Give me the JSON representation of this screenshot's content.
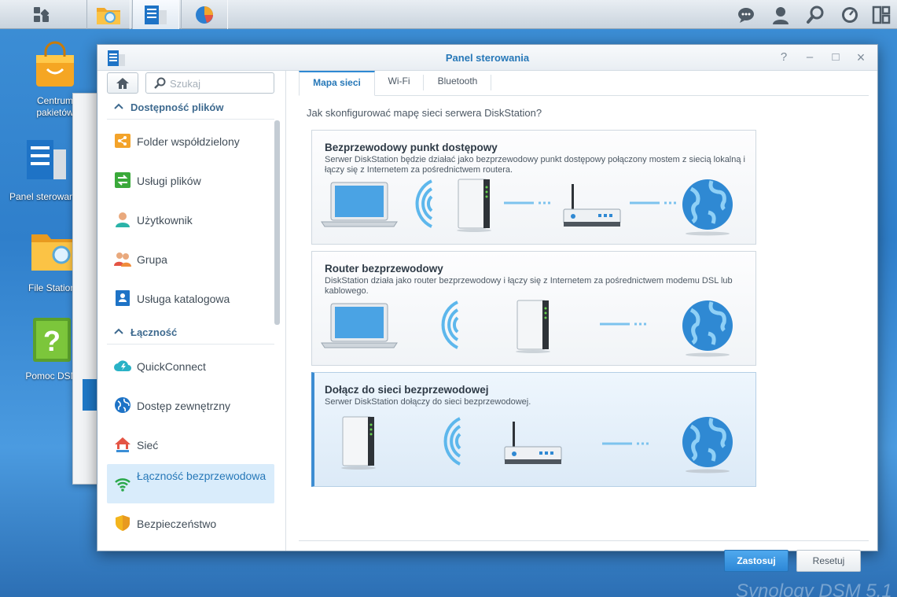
{
  "desktop": {
    "icons": [
      {
        "label": "Centrum pakietów"
      },
      {
        "label": "Panel sterowania"
      },
      {
        "label": "File Station"
      },
      {
        "label": "Pomoc DSM"
      }
    ],
    "watermark": "Synology DSM 5.1"
  },
  "window": {
    "title": "Panel sterowania",
    "controls": {
      "help": "?",
      "minimize": "–",
      "maximize": "□",
      "close": "×"
    }
  },
  "sidebar": {
    "search_placeholder": "Szukaj",
    "sections": [
      {
        "label": "Dostępność plików"
      },
      {
        "label": "Łączność"
      }
    ],
    "items": [
      {
        "label": "Folder współdzielony",
        "icon": "shared-folder-icon"
      },
      {
        "label": "Usługi plików",
        "icon": "file-services-icon"
      },
      {
        "label": "Użytkownik",
        "icon": "user-icon"
      },
      {
        "label": "Grupa",
        "icon": "group-icon"
      },
      {
        "label": "Usługa katalogowa",
        "icon": "directory-service-icon"
      },
      {
        "label": "QuickConnect",
        "icon": "quickconnect-icon"
      },
      {
        "label": "Dostęp zewnętrzny",
        "icon": "external-access-icon"
      },
      {
        "label": "Sieć",
        "icon": "network-icon"
      },
      {
        "label": "Łączność bezprzewodowa",
        "icon": "wireless-icon"
      },
      {
        "label": "Bezpieczeństwo",
        "icon": "security-icon"
      }
    ]
  },
  "tabs": [
    {
      "label": "Mapa sieci"
    },
    {
      "label": "Wi-Fi"
    },
    {
      "label": "Bluetooth"
    }
  ],
  "content": {
    "question": "Jak skonfigurować mapę sieci serwera DiskStation?",
    "options": [
      {
        "title": "Bezprzewodowy punkt dostępowy",
        "desc": "Serwer DiskStation będzie działać jako bezprzewodowy punkt dostępowy połączony mostem z siecią lokalną i łączy się z Internetem za pośrednictwem routera."
      },
      {
        "title": "Router bezprzewodowy",
        "desc": "DiskStation działa jako router bezprzewodowy i łączy się z Internetem za pośrednictwem modemu DSL lub kablowego."
      },
      {
        "title": "Dołącz do sieci bezprzewodowej",
        "desc": "Serwer DiskStation dołączy do sieci bezprzewodowej."
      }
    ],
    "selected_option": "Dołącz do sieci bezprzewodowej"
  },
  "buttons": {
    "apply": "Zastosuj",
    "reset": "Resetuj"
  },
  "colors": {
    "accent": "#2778b8",
    "apply_button": "#3a96e1",
    "selected_row": "#d9ecfb"
  }
}
